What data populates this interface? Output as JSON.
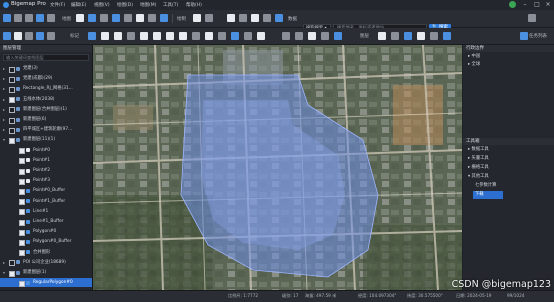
{
  "app": {
    "title": "Bigemap Pro",
    "menus": [
      "文件(F)",
      "编辑(E)",
      "视图(V)",
      "绘图(D)",
      "地图(M)",
      "工具(T)",
      "帮助(H)"
    ]
  },
  "toolbar1": {
    "map_label": "地图",
    "draw_label": "绘制",
    "data_label": "数据",
    "source_dropdown": "搜狗搜索",
    "search_placeholder": "搜索地名、坐标或者地址",
    "search_button": "搜索"
  },
  "toolbar2": {
    "mark_label": "标记",
    "layer_label": "图层",
    "task_label": "任务列表"
  },
  "left_panel": {
    "title": "图层管理",
    "search_placeholder": "输入关键词查找图层",
    "layers": [
      {
        "arrow": "▸",
        "checked": false,
        "icon": "#6a93c9",
        "label": "党建(3)",
        "indent": 0,
        "selected": false
      },
      {
        "arrow": "▸",
        "checked": false,
        "icon": "#6a93c9",
        "label": "党建(成都)(29)",
        "indent": 0,
        "selected": false
      },
      {
        "arrow": "▸",
        "checked": false,
        "icon": "#6a93c9",
        "label": "Rectangle_RJ_网格(31...",
        "indent": 0,
        "selected": false
      },
      {
        "arrow": "▸",
        "checked": true,
        "icon": "#6a93c9",
        "label": "五线水体(2038)",
        "indent": 0,
        "selected": false
      },
      {
        "arrow": "▸",
        "checked": false,
        "icon": "#6a93c9",
        "label": "新建图层(合并图层)(1)",
        "indent": 0,
        "selected": false
      },
      {
        "arrow": "▸",
        "checked": false,
        "icon": "#6a93c9",
        "label": "新建图层(6)",
        "indent": 0,
        "selected": false
      },
      {
        "arrow": "▸",
        "checked": false,
        "icon": "#6a93c9",
        "label": "四平城区+建筑轮廓(97...",
        "indent": 0,
        "selected": false
      },
      {
        "arrow": "▾",
        "checked": true,
        "icon": "#6a93c9",
        "label": "新建图层(11)(1)",
        "indent": 0,
        "selected": false
      },
      {
        "arrow": "",
        "checked": true,
        "icon": "#e8ebef",
        "label": "Point#0",
        "indent": 1,
        "selected": false
      },
      {
        "arrow": "",
        "checked": true,
        "icon": "#e8ebef",
        "label": "Point#1",
        "indent": 1,
        "selected": false
      },
      {
        "arrow": "",
        "checked": true,
        "icon": "#e8ebef",
        "label": "Point#2",
        "indent": 1,
        "selected": false
      },
      {
        "arrow": "",
        "checked": true,
        "icon": "#e8ebef",
        "label": "Point#3",
        "indent": 1,
        "selected": false
      },
      {
        "arrow": "",
        "checked": true,
        "icon": "#4a8fe0",
        "label": "Point#0_Buffer",
        "indent": 1,
        "selected": false
      },
      {
        "arrow": "",
        "checked": true,
        "icon": "#4a8fe0",
        "label": "Point#1_Buffer",
        "indent": 1,
        "selected": false
      },
      {
        "arrow": "",
        "checked": true,
        "icon": "#4a8fe0",
        "label": "Line#1",
        "indent": 1,
        "selected": false
      },
      {
        "arrow": "",
        "checked": true,
        "icon": "#4a8fe0",
        "label": "Line#1_Buffer",
        "indent": 1,
        "selected": false
      },
      {
        "arrow": "",
        "checked": true,
        "icon": "#4a8fe0",
        "label": "Polygon#0",
        "indent": 1,
        "selected": false
      },
      {
        "arrow": "",
        "checked": true,
        "icon": "#4a8fe0",
        "label": "Polygon#0_Buffer",
        "indent": 1,
        "selected": false
      },
      {
        "arrow": "",
        "checked": true,
        "icon": "#4a8fe0",
        "label": "合并图形",
        "indent": 1,
        "selected": false
      },
      {
        "arrow": "▸",
        "checked": false,
        "icon": "#6a93c9",
        "label": "POI 公司企业(18689)",
        "indent": 0,
        "selected": false
      },
      {
        "arrow": "▾",
        "checked": true,
        "icon": "#6a93c9",
        "label": "新建图层(1)",
        "indent": 0,
        "selected": false
      },
      {
        "arrow": "",
        "checked": true,
        "icon": "#4a8fe0",
        "label": "RegularPolygon#0",
        "indent": 1,
        "selected": true
      }
    ]
  },
  "right_panel": {
    "admin_title": "行政边界",
    "admin_items": [
      "▸ 中国",
      "▸ 全球"
    ],
    "tools_title": "工具箱",
    "tools_items": [
      {
        "label": "▸ 数据工具",
        "selected": false
      },
      {
        "label": "▸ 矢量工具",
        "selected": false
      },
      {
        "label": "▸ 栅格工具",
        "selected": false
      },
      {
        "label": "▾ 其他工具",
        "selected": false
      },
      {
        "label": "七参数计算",
        "selected": false
      },
      {
        "label": "下载",
        "selected": true
      }
    ]
  },
  "status": {
    "scale": "比例尺: 1:7772",
    "level": "级别: 17",
    "height": "海拔: 497.59 米",
    "lng": "经度: 104.097304°",
    "lat": "纬度: 30.575500°",
    "date": "日期: 2024-05-19",
    "progress": "99/1024"
  },
  "watermark": "CSDN @bigemap123",
  "colors": {
    "accent": "#2f7de1",
    "buffer_fill": "#6f8fe8",
    "selection": "#2d6fd0"
  }
}
